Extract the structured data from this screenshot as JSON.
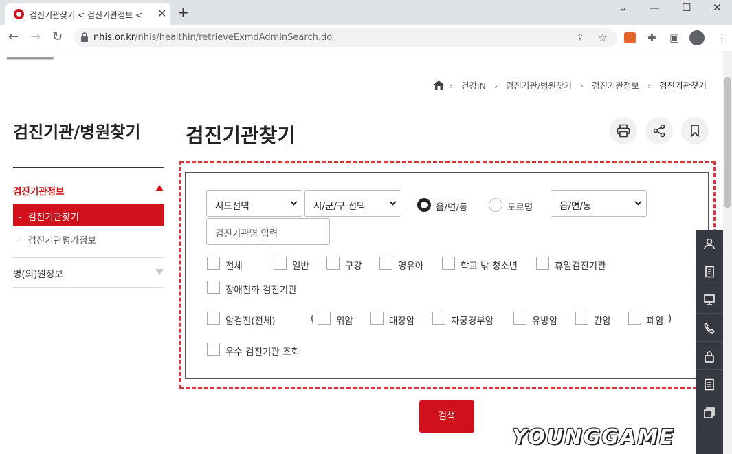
{
  "browser": {
    "tab_title": "검진기관찾기 < 검진기관정보 < ",
    "url_host": "nhis.or.kr",
    "url_path": "/nhis/healthin/retrieveExmdAdminSearch.do"
  },
  "breadcrumb": {
    "items": [
      "건강iN",
      "검진기관/병원찾기",
      "검진기관정보",
      "검진기관찾기"
    ]
  },
  "sidebar": {
    "title": "검진기관/병원찾기",
    "group1": "검진기관정보",
    "sub_active": "검진기관찾기",
    "sub_2": "검진기관평가정보",
    "group2": "병(의)원정보"
  },
  "main": {
    "title": "검진기관찾기"
  },
  "form": {
    "sido_select": "시도선택",
    "sigungu_select": "시/군/구 선택",
    "radio_1": "읍/면/동",
    "radio_2": "도로명",
    "dong_select": "읍/면/동",
    "name_placeholder": "검진기관명 입력",
    "checks_row1": [
      "전체",
      "일반",
      "구강",
      "영유아",
      "학교 밖 청소년",
      "휴일검진기관"
    ],
    "check_disabled": "장애친화 검진기관",
    "cancer_all": "암검진(전체)",
    "paren_open": "(",
    "paren_close": ")",
    "cancer_types": [
      "위암",
      "대장암",
      "자궁경부암",
      "유방암",
      "간암",
      "폐암"
    ],
    "excellent": "우수 검진기관 조회"
  },
  "search_button": "검색",
  "watermark": "YOUNGGAME",
  "colors": {
    "accent": "#d0111b",
    "dash": "#e0313b",
    "quickbar": "#36393f"
  }
}
